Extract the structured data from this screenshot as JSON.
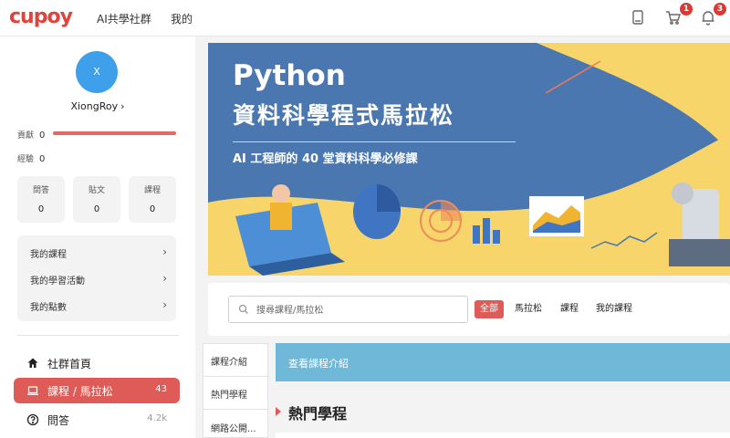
{
  "header": {
    "logo": "cupoy",
    "nav": [
      "AI共學社群",
      "我的"
    ],
    "cart_badge": "1",
    "bell_badge": "3"
  },
  "profile": {
    "avatar_initial": "X",
    "name": "XiongRoy",
    "contribution_label": "貢獻",
    "contribution_value": "0",
    "contribution_level": 1.0,
    "experience_label": "經驗",
    "experience_value": "0",
    "stats": [
      {
        "label": "問答",
        "value": "0"
      },
      {
        "label": "貼文",
        "value": "0"
      },
      {
        "label": "課程",
        "value": "0"
      }
    ],
    "menu": [
      "我的課程",
      "我的學習活動",
      "我的點數"
    ]
  },
  "sidebar_nav": [
    {
      "label": "社群首頁",
      "count": ""
    },
    {
      "label": "課程 / 馬拉松",
      "count": "43"
    },
    {
      "label": "問答",
      "count": "4.2k"
    }
  ],
  "banner": {
    "title": "Python",
    "title2": "資料科學程式馬拉松",
    "subtitle": "AI 工程師的 40 堂資料科學必修課"
  },
  "search": {
    "placeholder": "搜尋課程/馬拉松",
    "filters": [
      "全部",
      "馬拉松",
      "課程",
      "我的課程"
    ]
  },
  "content_tabs": [
    "課程介紹",
    "熱門學程",
    "網路公開..."
  ],
  "intro_link": "查看課程介紹",
  "section_title": "熱門學程",
  "colors": {
    "accent": "#de5b57",
    "banner_blue": "#4a77b0",
    "banner_yellow": "#f7d56b",
    "strip_blue": "#6fb8d8"
  }
}
